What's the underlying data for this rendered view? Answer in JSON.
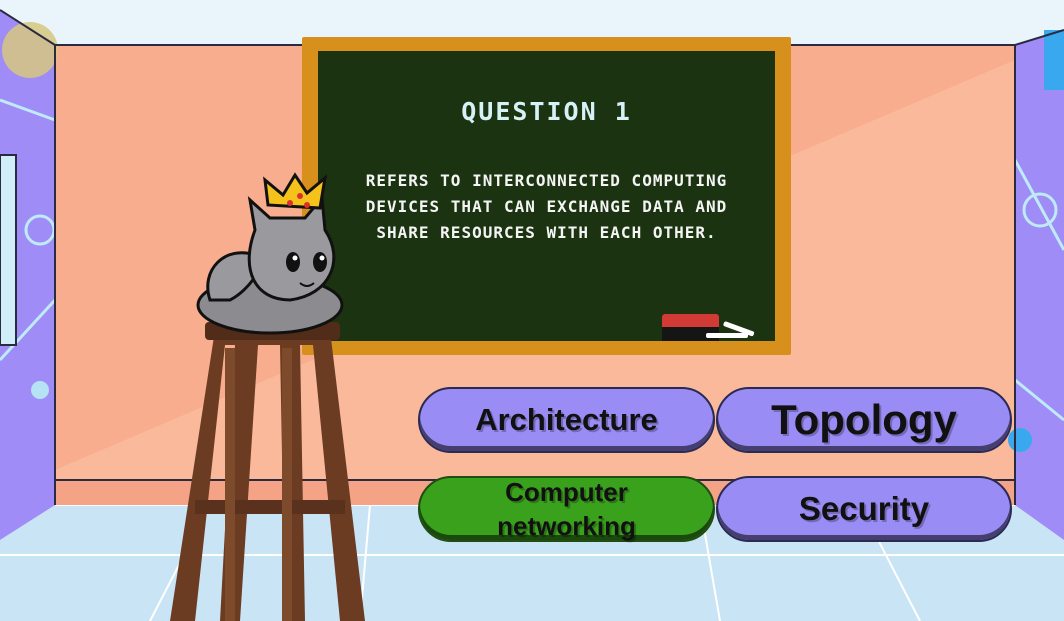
{
  "question": {
    "title": "QUESTION 1",
    "text": "REFERS TO INTERCONNECTED COMPUTING DEVICES THAT CAN EXCHANGE DATA AND SHARE RESOURCES WITH EACH OTHER."
  },
  "answers": [
    {
      "label": "Architecture",
      "color": "#9a8cf5"
    },
    {
      "label": "Topology",
      "color": "#9a8cf5"
    },
    {
      "label": "Computer networking",
      "color": "#3aa11d"
    },
    {
      "label": "Security",
      "color": "#9a8cf5"
    }
  ],
  "colors": {
    "back_wall": "#fbb99b",
    "side_walls": "#9f8cf7",
    "floor": "#c9e4f5",
    "board_frame": "#d8901d",
    "board_surface": "#1c3311"
  },
  "icons": [
    "cat-icon",
    "crown-icon",
    "stool-icon",
    "eraser-icon",
    "chalk-icon"
  ]
}
